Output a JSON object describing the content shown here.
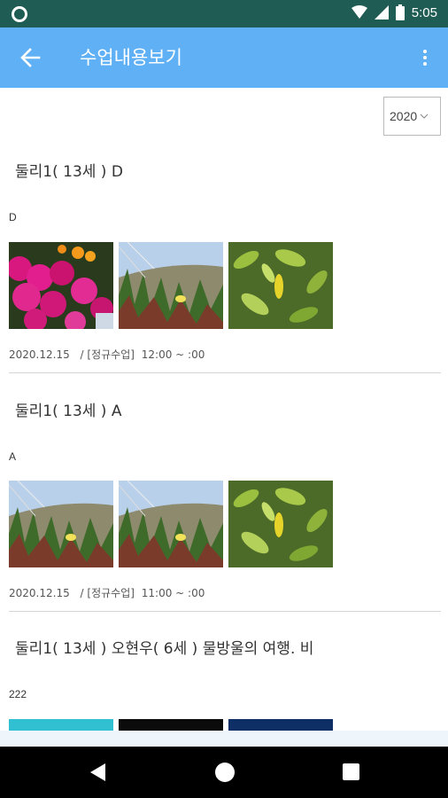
{
  "status_bar": {
    "time": "5:05"
  },
  "app_bar": {
    "title": "수업내용보기"
  },
  "filter": {
    "year": "2020"
  },
  "lessons": [
    {
      "title": "둘리1( 13세 ) D",
      "note": "D",
      "date": "2020.12.15",
      "category": "/ [정규수업]",
      "time": "12:00 ~ :00",
      "photos": [
        "pink-flowers-photo",
        "grass-butterfly-photo",
        "green-leaves-photo"
      ]
    },
    {
      "title": "둘리1( 13세 ) A",
      "note": "A",
      "date": "2020.12.15",
      "category": "/ [정규수업]",
      "time": "11:00 ~ :00",
      "photos": [
        "grass-butterfly-photo",
        "grass-butterfly-photo",
        "green-leaves-photo"
      ]
    },
    {
      "title": "둘리1( 13세 ) 오현우( 6세 ) 물방울의 여행. 비",
      "note": "222",
      "photos": [
        "cyan-photo",
        "dark-photo",
        "blue-sparkle-photo"
      ]
    }
  ],
  "colors": {
    "status_bar": "#1f5c53",
    "app_bar": "#5fb0f5",
    "nav_bar": "#000000"
  }
}
